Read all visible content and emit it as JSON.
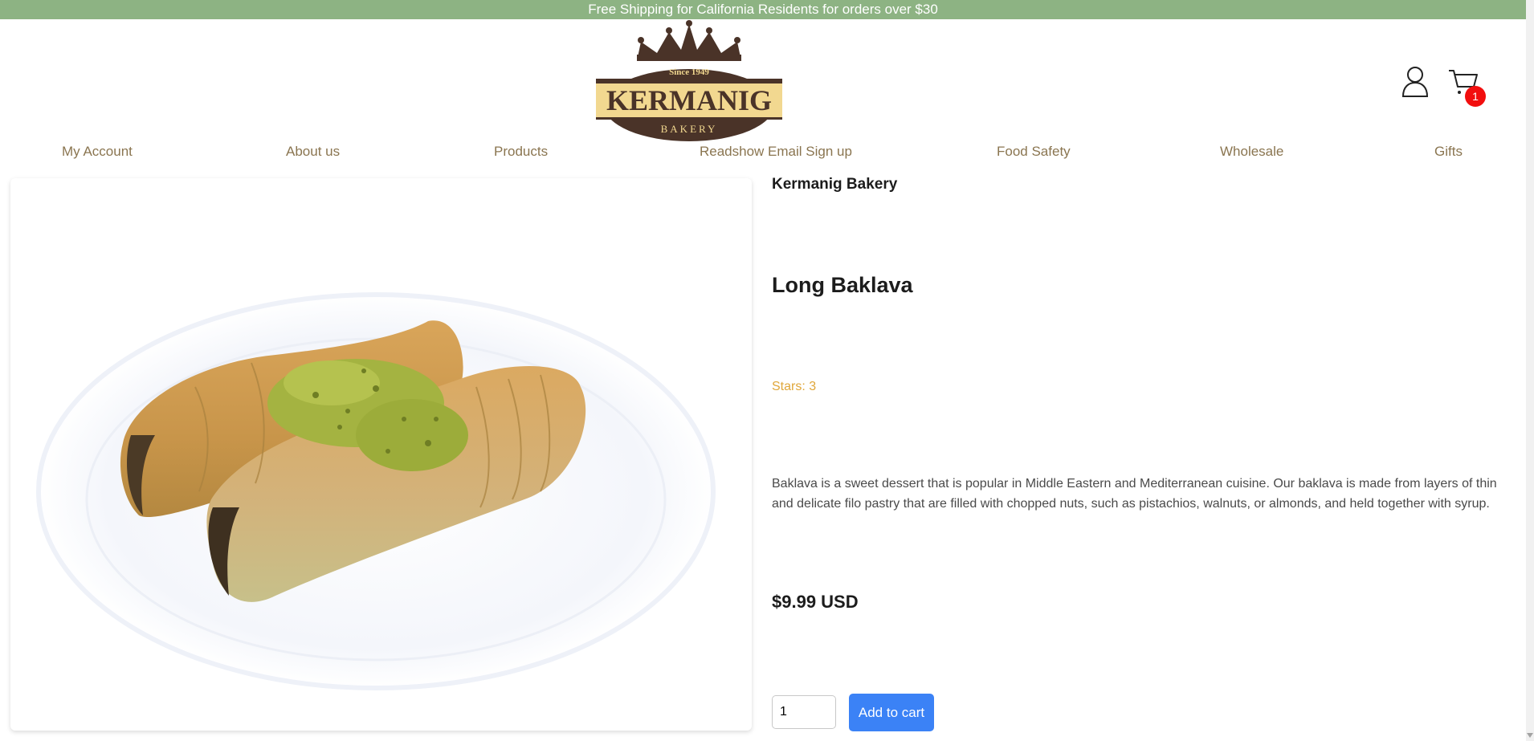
{
  "announcement": "Free Shipping for California Residents for orders over $30",
  "logo": {
    "since": "Since 1949",
    "name": "KERMANIG",
    "sub": "BAKERY"
  },
  "header": {
    "account_icon": "user-icon",
    "cart_icon": "cart-icon",
    "cart_count": "1"
  },
  "nav": {
    "items": [
      {
        "label": "My Account"
      },
      {
        "label": "About us"
      },
      {
        "label": "Products"
      },
      {
        "label": "Readshow Email Sign up"
      },
      {
        "label": "Food Safety"
      },
      {
        "label": "Wholesale"
      },
      {
        "label": "Gifts"
      }
    ]
  },
  "product": {
    "vendor": "Kermanig Bakery",
    "title": "Long Baklava",
    "stars": "Stars: 3",
    "description": "Baklava is a sweet dessert that is popular in Middle Eastern and Mediterranean cuisine. Our baklava is made from layers of thin and delicate filo pastry that are filled with chopped nuts, such as pistachios, walnuts, or almonds, and held together with syrup.",
    "price": "$9.99 USD",
    "quantity": "1",
    "add_to_cart": "Add to cart"
  },
  "colors": {
    "announcement_bg": "#8db383",
    "nav_text": "#8a7550",
    "stars": "#e0a73a",
    "button": "#3b82f6",
    "badge": "#f20e0e",
    "logo_brown": "#4a3328",
    "logo_gold": "#f2d890"
  }
}
